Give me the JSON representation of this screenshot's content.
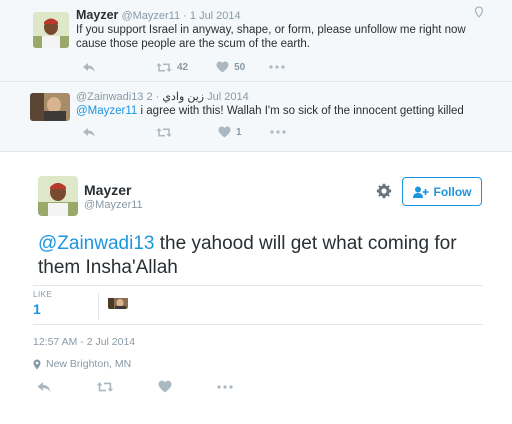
{
  "tweet1": {
    "name": "Mayzer",
    "handle": "@Mayzer11",
    "date": "1 Jul 2014",
    "text": "If you support Israel in anyway, shape, or form, please unfollow me right now cause those people are the scum of the earth.",
    "retweet_count": "42",
    "like_count": "50"
  },
  "tweet2": {
    "handle": "@Zainwadi13",
    "display_name": "زين وادي",
    "date": "2 Jul 2014",
    "mention": "@Mayzer11",
    "text": " i agree with this! Wallah I'm so sick of the innocent getting killed",
    "like_count": "1"
  },
  "main": {
    "name": "Mayzer",
    "handle": "@Mayzer11",
    "follow_label": "Follow",
    "mention": "@Zainwadi13",
    "text": " the yahood will get what coming for them Insha'Allah",
    "like_label": "LIKE",
    "like_count": "1",
    "timestamp": "12:57 AM - 2 Jul 2014",
    "location": "New Brighton, MN"
  },
  "colors": {
    "link": "#1b95e0",
    "muted": "#8899a6",
    "text": "#292f33"
  },
  "icons": [
    "reply-icon",
    "retweet-icon",
    "heart-icon",
    "more-icon",
    "chevron-down-icon",
    "gear-icon",
    "follow-person-icon",
    "location-pin-icon"
  ]
}
